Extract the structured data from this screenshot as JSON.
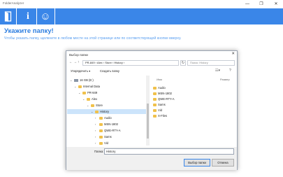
{
  "window": {
    "title": "FolderAnalyzer",
    "controls": [
      "—",
      "❐",
      "✕"
    ]
  },
  "toolbar": {
    "buttons": [
      {
        "icon": "door-exit-icon"
      },
      {
        "icon": "info-icon",
        "glyph": "i"
      },
      {
        "icon": "smiley-icon",
        "glyph": "☺"
      }
    ],
    "color": "#3a86e8"
  },
  "main": {
    "heading": "Укажите папку!",
    "subtext": "Чтобы указать папку, щелкните в любом месте на этой странице или по соответствующей кнопке вверху."
  },
  "dialog": {
    "title": "Выбор папки",
    "address": "PR-849  ›  Alex  ›  Store  ›  History  ›",
    "search_placeholder": "Поиск: History",
    "organize_label": "Упорядочить ▾",
    "new_folder_label": "Создать папку",
    "columns": {
      "name": "Имя",
      "size": "Размер"
    },
    "tree": [
      {
        "label": "16 GB (E:)",
        "depth": 0,
        "kind": "disk",
        "expanded": true
      },
      {
        "label": "Internal Data",
        "depth": 1,
        "kind": "folder",
        "expanded": true
      },
      {
        "label": "PR-849",
        "depth": 2,
        "kind": "folder",
        "expanded": true
      },
      {
        "label": "Alex",
        "depth": 3,
        "kind": "folder",
        "expanded": true
      },
      {
        "label": "Store",
        "depth": 4,
        "kind": "folder",
        "expanded": true
      },
      {
        "label": "History",
        "depth": 5,
        "kind": "folder",
        "expanded": true,
        "selected": true
      },
      {
        "label": "Audio",
        "depth": 6,
        "kind": "folder"
      },
      {
        "label": "MSN-1802",
        "depth": 6,
        "kind": "folder"
      },
      {
        "label": "QWE-RTY-A",
        "depth": 6,
        "kind": "folder"
      },
      {
        "label": "Sams",
        "depth": 6,
        "kind": "folder"
      },
      {
        "label": "Vid",
        "depth": 6,
        "kind": "folder"
      },
      {
        "label": "X-Files",
        "depth": 6,
        "kind": "folder"
      }
    ],
    "files": [
      "Audio",
      "MSN-1802",
      "QWE-RTY-A",
      "Sams",
      "Vid",
      "X-Files"
    ],
    "folder_label": "Папка:",
    "folder_value": "History",
    "ok_label": "Выбор папки",
    "cancel_label": "Отмена"
  }
}
